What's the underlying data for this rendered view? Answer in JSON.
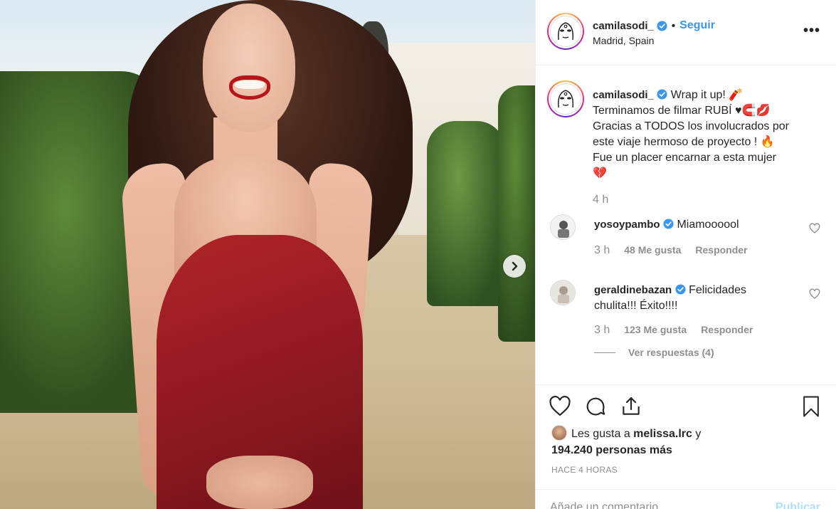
{
  "post": {
    "username": "camilasodi_",
    "follow_label": "Seguir",
    "separator": "•",
    "location": "Madrid, Spain",
    "more_label": "•••"
  },
  "caption": {
    "username": "camilasodi_",
    "lines": [
      "Wrap it up! 🧨",
      "Terminamos de filmar RUBÍ ♥🧲💋",
      "Gracias a TODOS los involucrados por",
      "este viaje hermoso de proyecto ! 🔥",
      "Fue un placer encarnar a esta mujer",
      "💔"
    ],
    "time": "4 h"
  },
  "comments": [
    {
      "username": "yosoypambo",
      "text": "Miamoooool",
      "time": "3 h",
      "likes": "48 Me gusta",
      "reply": "Responder"
    },
    {
      "username": "geraldinebazan",
      "text": "Felicidades chulita!!! Éxito!!!!",
      "time": "3 h",
      "likes": "123 Me gusta",
      "reply": "Responder",
      "view_replies": "Ver respuestas (4)"
    }
  ],
  "likes": {
    "prefix": "Les gusta a ",
    "user": "melissa.lrc",
    "middle": " y",
    "count": "194.240 personas más"
  },
  "ago": "HACE 4 HORAS",
  "add_comment": {
    "placeholder": "Añade un comentario...",
    "publish_label": "Publicar"
  },
  "colors": {
    "link": "#3897f0",
    "verified": "#3897f0",
    "muted": "#8e8e8e",
    "publish_disabled": "#b2dffc"
  }
}
